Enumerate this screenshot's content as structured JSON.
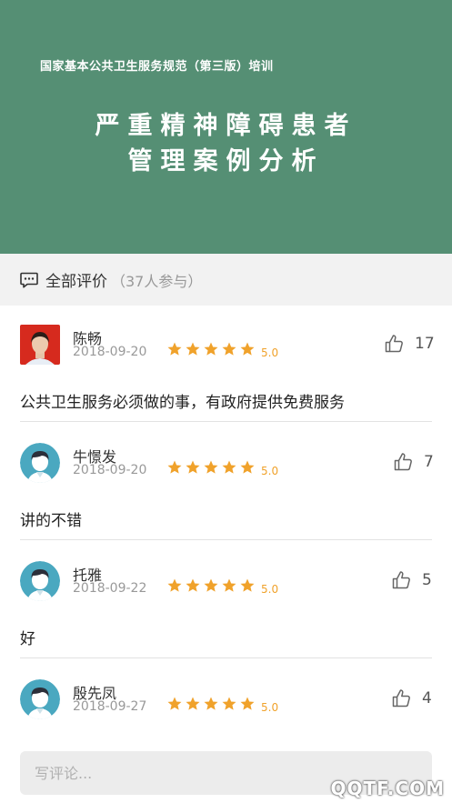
{
  "banner": {
    "subtitle": "国家基本公共卫生服务规范（第三版）培训",
    "title_line1": "严重精神障碍患者",
    "title_line2": "管理案例分析"
  },
  "reviews_header": {
    "title": "全部评价",
    "count": "（37人参与）"
  },
  "comments": [
    {
      "name": "陈畅",
      "date": "2018-09-20",
      "rating": 5,
      "score": "5.0",
      "likes": "17",
      "text": "公共卫生服务必须做的事，有政府提供免费服务",
      "avatar": "photo"
    },
    {
      "name": "牛憬发",
      "date": "2018-09-20",
      "rating": 5,
      "score": "5.0",
      "likes": "7",
      "text": "讲的不错",
      "avatar": "default"
    },
    {
      "name": "托雅",
      "date": "2018-09-22",
      "rating": 5,
      "score": "5.0",
      "likes": "5",
      "text": "好",
      "avatar": "default"
    },
    {
      "name": "殷先凤",
      "date": "2018-09-27",
      "rating": 5,
      "score": "5.0",
      "likes": "4",
      "text": "",
      "avatar": "default"
    }
  ],
  "comment_input": {
    "placeholder": "写评论..."
  },
  "watermark": "QQTF.COM",
  "colors": {
    "banner": "#558f74",
    "star": "#f0a22b",
    "avatar_bg": "#4aa8c0"
  },
  "icons": [
    "chat-bubble-icon",
    "star-icon",
    "thumbs-up-icon",
    "avatar-icon"
  ]
}
